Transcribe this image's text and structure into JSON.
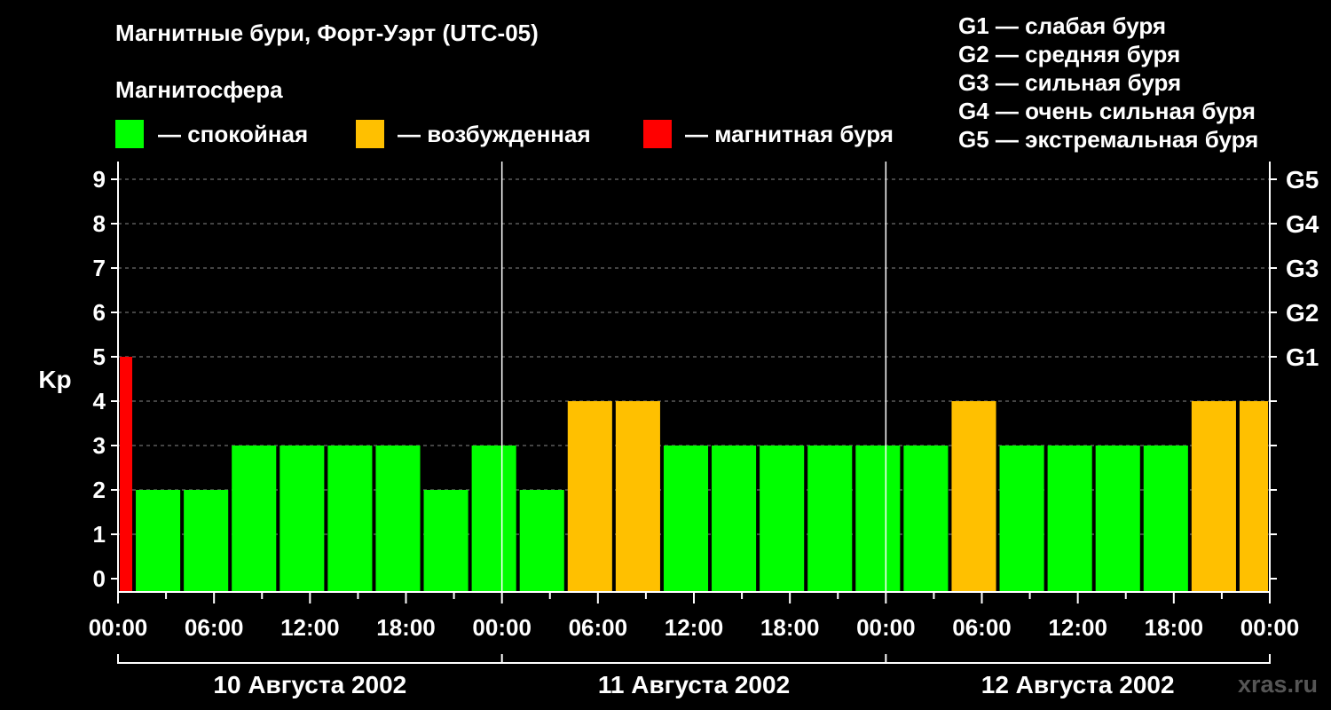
{
  "title": "Магнитные бури, Форт-Уэрт (UTC-05)",
  "legend": {
    "heading": "Магнитосфера",
    "items": [
      {
        "label": "— спокойная",
        "color": "#00ff00"
      },
      {
        "label": "— возбужденная",
        "color": "#ffc000"
      },
      {
        "label": "— магнитная буря",
        "color": "#ff0000"
      }
    ],
    "storm_levels": [
      "G1 — слабая буря",
      "G2 — средняя буря",
      "G3 — сильная буря",
      "G4 — очень сильная буря",
      "G5 — экстремальная буря"
    ]
  },
  "watermark": "xras.ru",
  "chart_data": {
    "type": "bar",
    "ylabel": "Kp",
    "ylim": [
      0,
      9
    ],
    "yticks": [
      0,
      1,
      2,
      3,
      4,
      5,
      6,
      7,
      8,
      9
    ],
    "g_scale": [
      {
        "kp": 5,
        "label": "G1"
      },
      {
        "kp": 6,
        "label": "G2"
      },
      {
        "kp": 7,
        "label": "G3"
      },
      {
        "kp": 8,
        "label": "G4"
      },
      {
        "kp": 9,
        "label": "G5"
      }
    ],
    "x_hours_range": [
      0,
      72
    ],
    "xtick_labels": [
      "00:00",
      "06:00",
      "12:00",
      "18:00",
      "00:00",
      "06:00",
      "12:00",
      "18:00",
      "00:00",
      "06:00",
      "12:00",
      "18:00",
      "00:00"
    ],
    "days": [
      "10 Августа 2002",
      "11 Августа 2002",
      "12 Августа 2002"
    ],
    "grid": true,
    "colors": {
      "quiet": "#00ff00",
      "unsettled": "#ffc000",
      "storm": "#ff0000"
    },
    "bars": [
      {
        "start": 0,
        "end": 1,
        "kp": 5,
        "status": "storm"
      },
      {
        "start": 1,
        "end": 4,
        "kp": 2,
        "status": "quiet"
      },
      {
        "start": 4,
        "end": 7,
        "kp": 2,
        "status": "quiet"
      },
      {
        "start": 7,
        "end": 10,
        "kp": 3,
        "status": "quiet"
      },
      {
        "start": 10,
        "end": 13,
        "kp": 3,
        "status": "quiet"
      },
      {
        "start": 13,
        "end": 16,
        "kp": 3,
        "status": "quiet"
      },
      {
        "start": 16,
        "end": 19,
        "kp": 3,
        "status": "quiet"
      },
      {
        "start": 19,
        "end": 22,
        "kp": 2,
        "status": "quiet"
      },
      {
        "start": 22,
        "end": 25,
        "kp": 3,
        "status": "quiet"
      },
      {
        "start": 25,
        "end": 28,
        "kp": 2,
        "status": "quiet"
      },
      {
        "start": 28,
        "end": 31,
        "kp": 4,
        "status": "unsettled"
      },
      {
        "start": 31,
        "end": 34,
        "kp": 4,
        "status": "unsettled"
      },
      {
        "start": 34,
        "end": 37,
        "kp": 3,
        "status": "quiet"
      },
      {
        "start": 37,
        "end": 40,
        "kp": 3,
        "status": "quiet"
      },
      {
        "start": 40,
        "end": 43,
        "kp": 3,
        "status": "quiet"
      },
      {
        "start": 43,
        "end": 46,
        "kp": 3,
        "status": "quiet"
      },
      {
        "start": 46,
        "end": 49,
        "kp": 3,
        "status": "quiet"
      },
      {
        "start": 49,
        "end": 52,
        "kp": 3,
        "status": "quiet"
      },
      {
        "start": 52,
        "end": 55,
        "kp": 4,
        "status": "unsettled"
      },
      {
        "start": 55,
        "end": 58,
        "kp": 3,
        "status": "quiet"
      },
      {
        "start": 58,
        "end": 61,
        "kp": 3,
        "status": "quiet"
      },
      {
        "start": 61,
        "end": 64,
        "kp": 3,
        "status": "quiet"
      },
      {
        "start": 64,
        "end": 67,
        "kp": 3,
        "status": "quiet"
      },
      {
        "start": 67,
        "end": 70,
        "kp": 4,
        "status": "unsettled"
      },
      {
        "start": 70,
        "end": 72,
        "kp": 4,
        "status": "unsettled"
      }
    ]
  }
}
